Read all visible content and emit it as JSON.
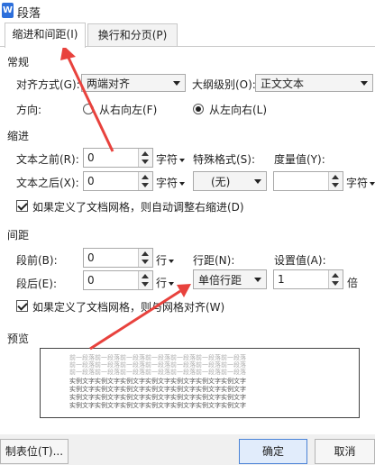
{
  "window": {
    "title": "段落",
    "icon": "w-app-icon"
  },
  "tabs": [
    {
      "label": "缩进和间距(I)",
      "active": true
    },
    {
      "label": "换行和分页(P)",
      "active": false
    }
  ],
  "general": {
    "section": "常规",
    "alignment_label": "对齐方式(G):",
    "alignment_value": "两端对齐",
    "outline_label": "大纲级别(O):",
    "outline_value": "正文文本",
    "direction_label": "方向:",
    "rtl_label": "从右向左(F)",
    "ltr_label": "从左向右(L)",
    "selected_direction": "ltr"
  },
  "indent": {
    "section": "缩进",
    "before_label": "文本之前(R):",
    "before_value": "0",
    "before_unit": "字符",
    "after_label": "文本之后(X):",
    "after_value": "0",
    "after_unit": "字符",
    "special_label": "特殊格式(S):",
    "special_value": "(无)",
    "measure_label": "度量值(Y):",
    "measure_value": "",
    "measure_unit": "字符",
    "grid_check_label": "如果定义了文档网格，则自动调整右缩进(D)",
    "grid_checked": true
  },
  "spacing": {
    "section": "间距",
    "before_label": "段前(B):",
    "before_value": "0",
    "before_unit": "行",
    "after_label": "段后(E):",
    "after_value": "0",
    "after_unit": "行",
    "line_label": "行距(N):",
    "line_value": "单倍行距",
    "setting_label": "设置值(A):",
    "setting_value": "1",
    "setting_unit": "倍",
    "grid_check_label": "如果定义了文档网格，则与网格对齐(W)",
    "grid_checked": true
  },
  "preview": {
    "section": "预览",
    "prev_line": "前一段落前一段落前一段落前一段落前一段落前一段落前一段落",
    "sample_line": "实例文字实例文字实例文字实例文字实例文字实例文字实例文字"
  },
  "footer": {
    "tabs_button": "制表位(T)...",
    "ok_button": "确定",
    "cancel_button": "取消"
  },
  "colors": {
    "annotation_arrow": "#e8423d",
    "primary_border": "#4a82d6"
  }
}
